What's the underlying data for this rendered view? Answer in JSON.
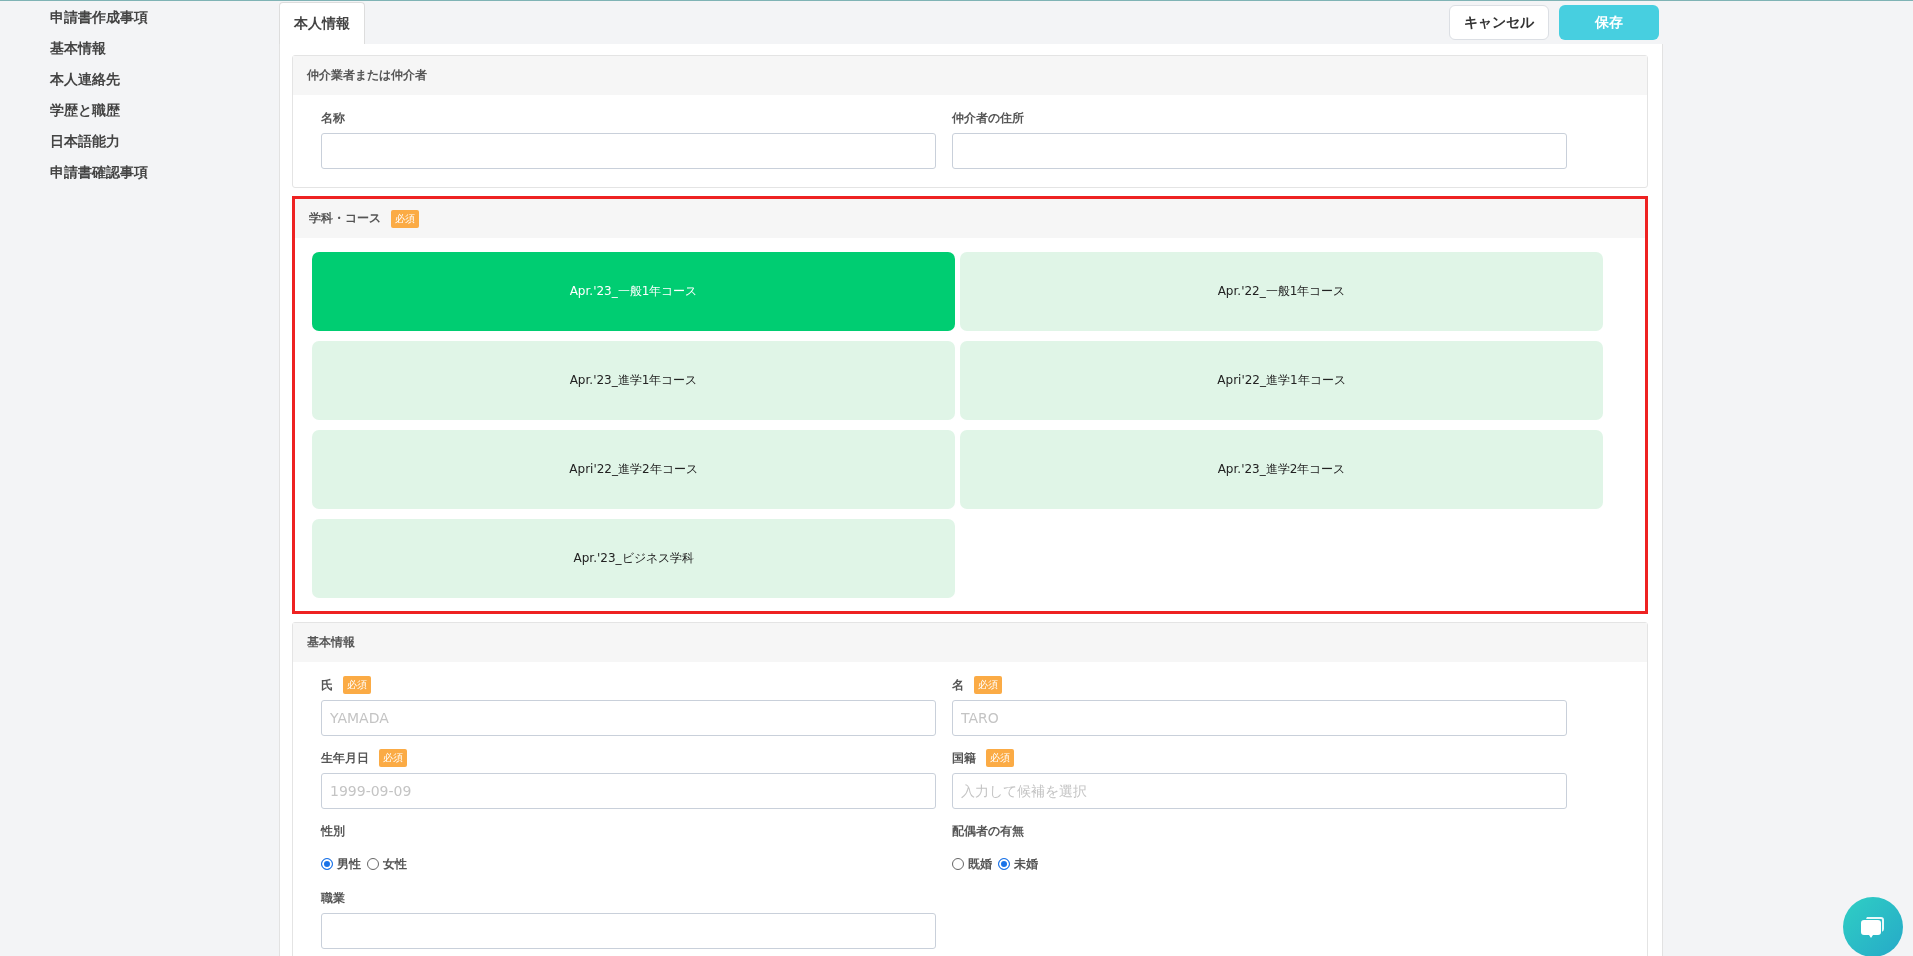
{
  "sidebar": {
    "items": [
      {
        "label": "申請書作成事項"
      },
      {
        "label": "基本情報"
      },
      {
        "label": "本人連絡先"
      },
      {
        "label": "学歴と職歴"
      },
      {
        "label": "日本語能力"
      },
      {
        "label": "申請書確認事項"
      }
    ]
  },
  "tabs": [
    {
      "label": "本人情報",
      "selected": true
    }
  ],
  "buttons": [
    {
      "label": "キャンセル",
      "kind": "secondary"
    },
    {
      "label": "保存",
      "kind": "primary"
    }
  ],
  "sections": [
    {
      "kind": "fields",
      "title": "仲介業者または仲介者",
      "highlighted": false,
      "fields": [
        {
          "kind": "text",
          "label": "名称"
        },
        {
          "kind": "text",
          "label": "仲介者の住所"
        }
      ]
    },
    {
      "kind": "choices",
      "title": "学科・コース",
      "badge": "必須",
      "highlighted": true,
      "options": [
        {
          "label": "Apr.'23_一般1年コース",
          "selected": true
        },
        {
          "label": "Apr.'22_一般1年コース",
          "selected": false
        },
        {
          "label": "Apr.'23_進学1年コース",
          "selected": false
        },
        {
          "label": "Apri'22_進学1年コース",
          "selected": false
        },
        {
          "label": "Apri'22_進学2年コース",
          "selected": false
        },
        {
          "label": "Apr.'23_進学2年コース",
          "selected": false
        },
        {
          "label": "Apr.'23_ビジネス学科",
          "selected": false
        }
      ]
    },
    {
      "kind": "fields",
      "title": "基本情報",
      "highlighted": false,
      "fields": [
        {
          "kind": "text",
          "label": "氏",
          "badge": "必須",
          "placeholder": "YAMADA"
        },
        {
          "kind": "text",
          "label": "名",
          "badge": "必須",
          "placeholder": "TARO"
        },
        {
          "kind": "text",
          "label": "生年月日",
          "badge": "必須",
          "placeholder": "1999-09-09"
        },
        {
          "kind": "text",
          "label": "国籍",
          "badge": "必須",
          "placeholder": "入力して候補を選択"
        },
        {
          "kind": "radio",
          "label": "性別",
          "options": [
            {
              "label": "男性",
              "selected": true
            },
            {
              "label": "女性",
              "selected": false
            }
          ]
        },
        {
          "kind": "radio",
          "label": "配偶者の有無",
          "options": [
            {
              "label": "既婚",
              "selected": false
            },
            {
              "label": "未婚",
              "selected": true
            }
          ]
        },
        {
          "kind": "text",
          "label": "職業"
        }
      ]
    }
  ]
}
